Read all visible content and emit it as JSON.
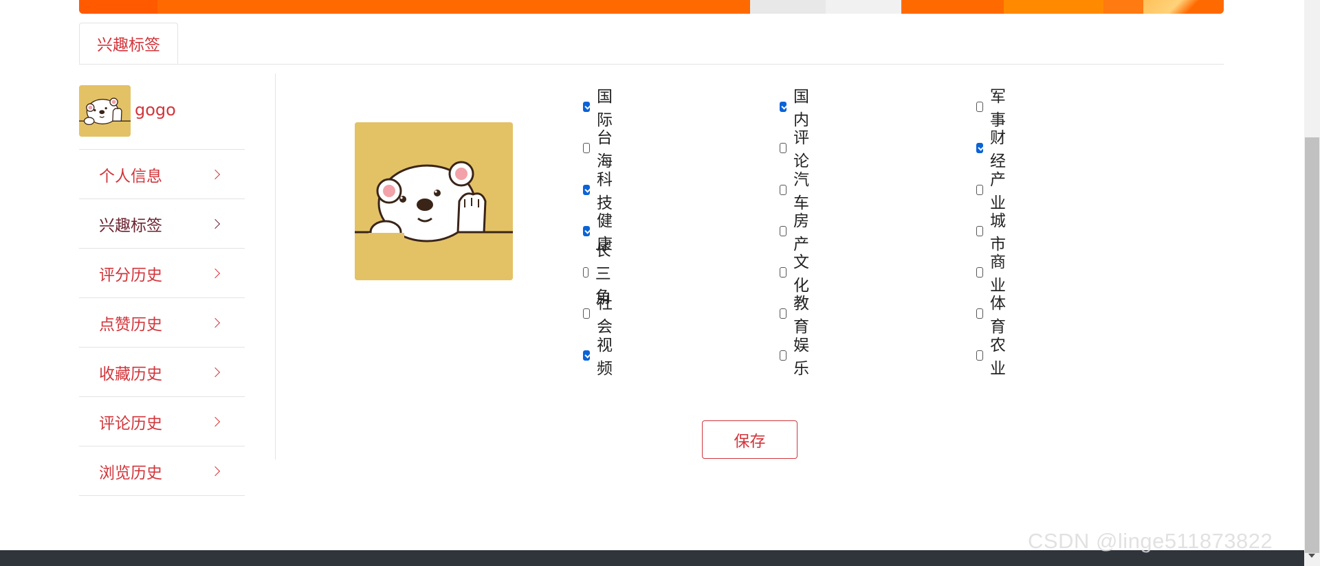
{
  "tabs": [
    {
      "label": "兴趣标签"
    }
  ],
  "user": {
    "name": "gogo",
    "avatar_icon": "bear-avatar-icon"
  },
  "menu": [
    {
      "label": "个人信息",
      "active": false
    },
    {
      "label": "兴趣标签",
      "active": true
    },
    {
      "label": "评分历史",
      "active": false
    },
    {
      "label": "点赞历史",
      "active": false
    },
    {
      "label": "收藏历史",
      "active": false
    },
    {
      "label": "评论历史",
      "active": false
    },
    {
      "label": "浏览历史",
      "active": false
    }
  ],
  "interests": [
    {
      "label": "国际",
      "checked": true
    },
    {
      "label": "国内",
      "checked": true
    },
    {
      "label": "军事",
      "checked": false
    },
    {
      "label": "台海",
      "checked": false
    },
    {
      "label": "评论",
      "checked": false
    },
    {
      "label": "财经",
      "checked": true
    },
    {
      "label": "科技",
      "checked": true
    },
    {
      "label": "汽车",
      "checked": false
    },
    {
      "label": "产业",
      "checked": false
    },
    {
      "label": "健康",
      "checked": true
    },
    {
      "label": "房产",
      "checked": false
    },
    {
      "label": "城市",
      "checked": false
    },
    {
      "label": "长三角",
      "checked": false
    },
    {
      "label": "文化",
      "checked": false
    },
    {
      "label": "商业",
      "checked": false
    },
    {
      "label": "社会",
      "checked": false
    },
    {
      "label": "教育",
      "checked": false
    },
    {
      "label": "体育",
      "checked": false
    },
    {
      "label": "视频",
      "checked": true
    },
    {
      "label": "娱乐",
      "checked": false
    },
    {
      "label": "农业",
      "checked": false
    }
  ],
  "actions": {
    "save_label": "保存"
  },
  "watermark": "CSDN @linge511873822",
  "colors": {
    "accent": "#d2353b",
    "check": "#0b63d8",
    "avatar_bg": "#e3c266",
    "banner": "#ff6a00",
    "footer": "#30343b"
  }
}
